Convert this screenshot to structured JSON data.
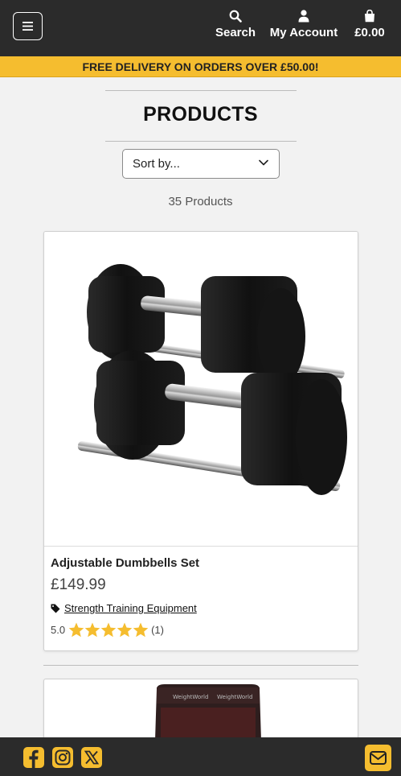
{
  "header": {
    "menu_icon": "hamburger-icon",
    "search_label": "Search",
    "account_label": "My Account",
    "basket_total": "£0.00"
  },
  "promo": {
    "text": "FREE DELIVERY ON ORDERS OVER £50.00!"
  },
  "page": {
    "title": "PRODUCTS",
    "sort_selected": "Sort by...",
    "product_count": "35 Products"
  },
  "products": [
    {
      "name": "Adjustable Dumbbells Set",
      "price": "£149.99",
      "category": "Strength Training Equipment",
      "rating_value": "5.0",
      "rating_stars": 5,
      "rating_count": "(1)"
    }
  ],
  "footer": {
    "icons": [
      "facebook-icon",
      "instagram-icon",
      "x-twitter-icon",
      "envelope-icon"
    ]
  },
  "colors": {
    "header_bg": "#2b2b2b",
    "accent": "#f5bd2f",
    "page_bg": "#f2f2f2"
  }
}
